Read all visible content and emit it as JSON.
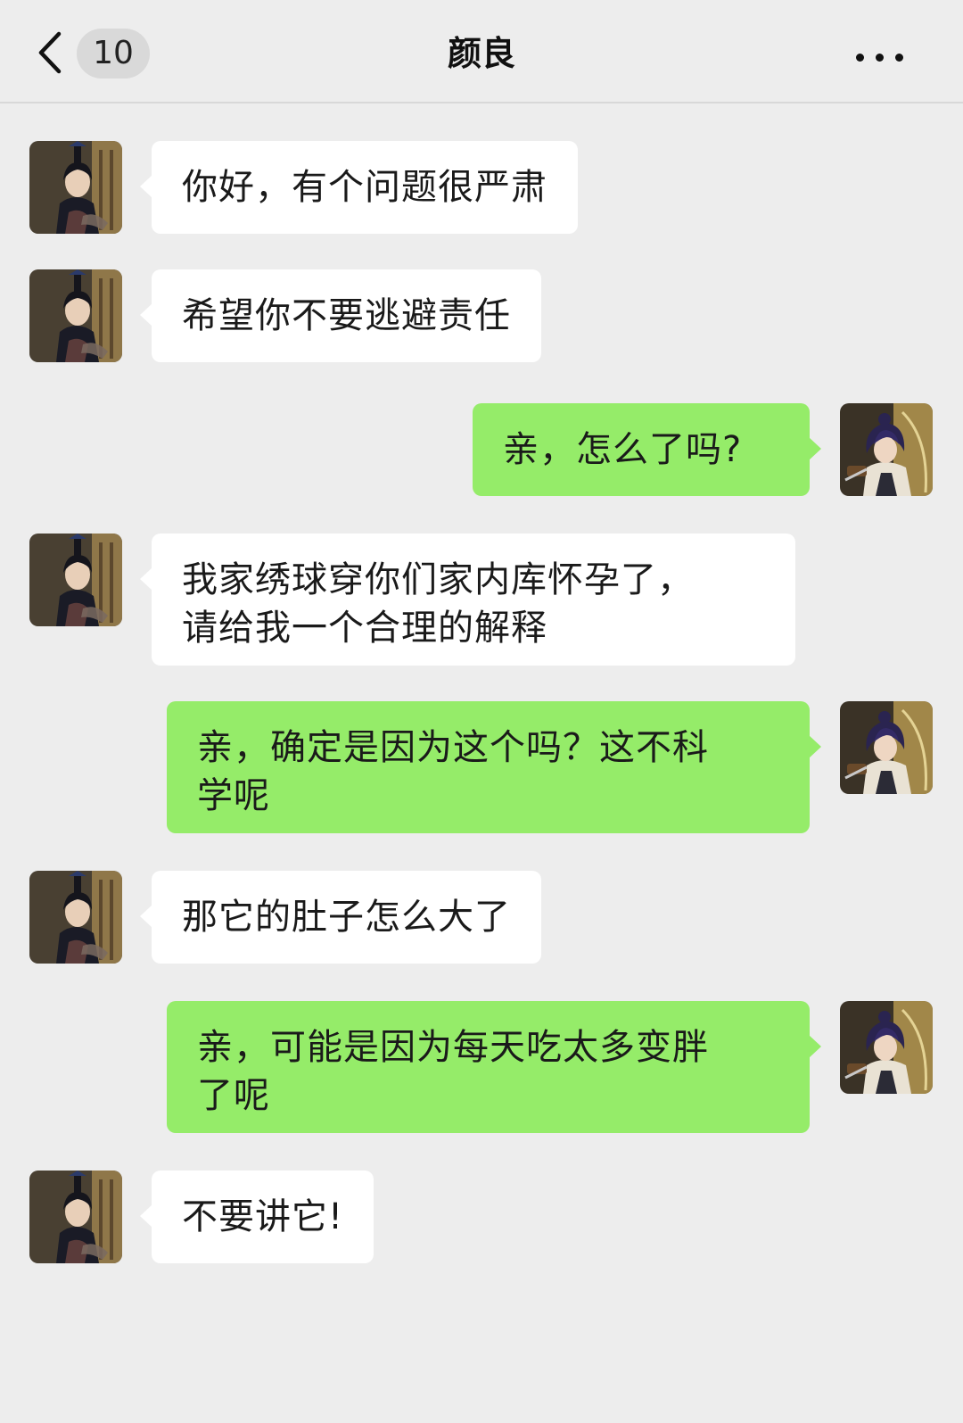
{
  "header": {
    "unread_count": "10",
    "title": "颜良",
    "back_icon": "chevron-left-icon",
    "more_icon": "more-dots-icon"
  },
  "colors": {
    "background": "#ededed",
    "incoming_bubble": "#ffffff",
    "outgoing_bubble": "#95ec69"
  },
  "messages": [
    {
      "sender": "颜良",
      "direction": "incoming",
      "text": "你好，有个问题很严肃"
    },
    {
      "sender": "颜良",
      "direction": "incoming",
      "text": "希望你不要逃避责任"
    },
    {
      "sender": "me",
      "direction": "outgoing",
      "text": "亲，怎么了吗?"
    },
    {
      "sender": "颜良",
      "direction": "incoming",
      "text": "我家绣球穿你们家内库怀孕了，\n请给我一个合理的解释"
    },
    {
      "sender": "me",
      "direction": "outgoing",
      "text": "亲，确定是因为这个吗？这不科\n学呢"
    },
    {
      "sender": "颜良",
      "direction": "incoming",
      "text": "那它的肚子怎么大了"
    },
    {
      "sender": "me",
      "direction": "outgoing",
      "text": "亲，可能是因为每天吃太多变胖\n了呢"
    },
    {
      "sender": "颜良",
      "direction": "incoming",
      "text": "不要讲它!"
    }
  ]
}
